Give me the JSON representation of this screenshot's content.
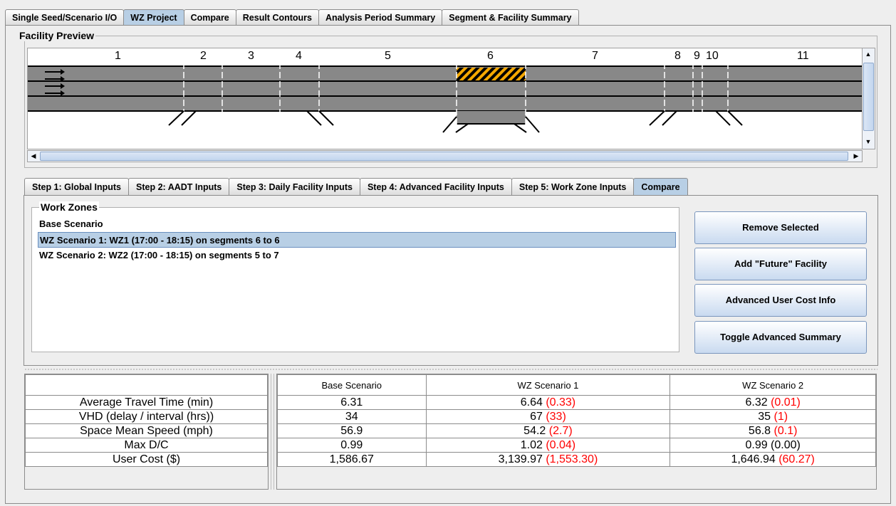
{
  "top_tabs": [
    {
      "label": "Single Seed/Scenario I/O",
      "active": false
    },
    {
      "label": "WZ Project",
      "active": true
    },
    {
      "label": "Compare",
      "active": false
    },
    {
      "label": "Result Contours",
      "active": false
    },
    {
      "label": "Analysis Period Summary",
      "active": false
    },
    {
      "label": "Segment & Facility Summary",
      "active": false
    }
  ],
  "facility_preview": {
    "title": "Facility Preview",
    "segments": [
      "1",
      "2",
      "3",
      "4",
      "5",
      "6",
      "7",
      "8",
      "9",
      "10",
      "11"
    ]
  },
  "step_tabs": [
    {
      "label": "Step 1: Global Inputs",
      "active": false
    },
    {
      "label": "Step 2: AADT Inputs",
      "active": false
    },
    {
      "label": "Step 3: Daily Facility Inputs",
      "active": false
    },
    {
      "label": "Step 4: Advanced Facility Inputs",
      "active": false
    },
    {
      "label": "Step 5: Work Zone Inputs",
      "active": false
    },
    {
      "label": "Compare",
      "active": true
    }
  ],
  "work_zones": {
    "title": "Work Zones",
    "items": [
      {
        "label": "Base Scenario",
        "selected": false
      },
      {
        "label": "WZ Scenario 1: WZ1 (17:00 - 18:15) on segments 6 to 6",
        "selected": true
      },
      {
        "label": "WZ Scenario 2: WZ2 (17:00 - 18:15) on segments 5 to 7",
        "selected": false
      }
    ]
  },
  "buttons": {
    "remove": "Remove Selected",
    "add_future": "Add \"Future\" Facility",
    "advanced_cost": "Advanced User Cost Info",
    "toggle_summary": "Toggle Advanced Summary"
  },
  "summary": {
    "columns": [
      "Base Scenario",
      "WZ Scenario 1",
      "WZ Scenario 2"
    ],
    "rows": [
      {
        "label": "Average Travel Time (min)",
        "cells": [
          {
            "v": "6.31",
            "d": ""
          },
          {
            "v": "6.64 ",
            "d": "(0.33)"
          },
          {
            "v": "6.32 ",
            "d": "(0.01)"
          }
        ]
      },
      {
        "label": "VHD (delay / interval (hrs))",
        "cells": [
          {
            "v": "34",
            "d": ""
          },
          {
            "v": "67 ",
            "d": "(33)"
          },
          {
            "v": "35 ",
            "d": "(1)"
          }
        ]
      },
      {
        "label": "Space Mean Speed (mph)",
        "cells": [
          {
            "v": "56.9",
            "d": ""
          },
          {
            "v": "54.2 ",
            "d": "(2.7)"
          },
          {
            "v": "56.8 ",
            "d": "(0.1)"
          }
        ]
      },
      {
        "label": "Max D/C",
        "cells": [
          {
            "v": "0.99",
            "d": ""
          },
          {
            "v": "1.02 ",
            "d": "(0.04)"
          },
          {
            "v": "0.99 (0.00)",
            "d": ""
          }
        ]
      },
      {
        "label": "User Cost ($)",
        "cells": [
          {
            "v": "1,586.67",
            "d": ""
          },
          {
            "v": "3,139.97 ",
            "d": "(1,553.30)"
          },
          {
            "v": "1,646.94 ",
            "d": "(60.27)"
          }
        ]
      }
    ]
  }
}
